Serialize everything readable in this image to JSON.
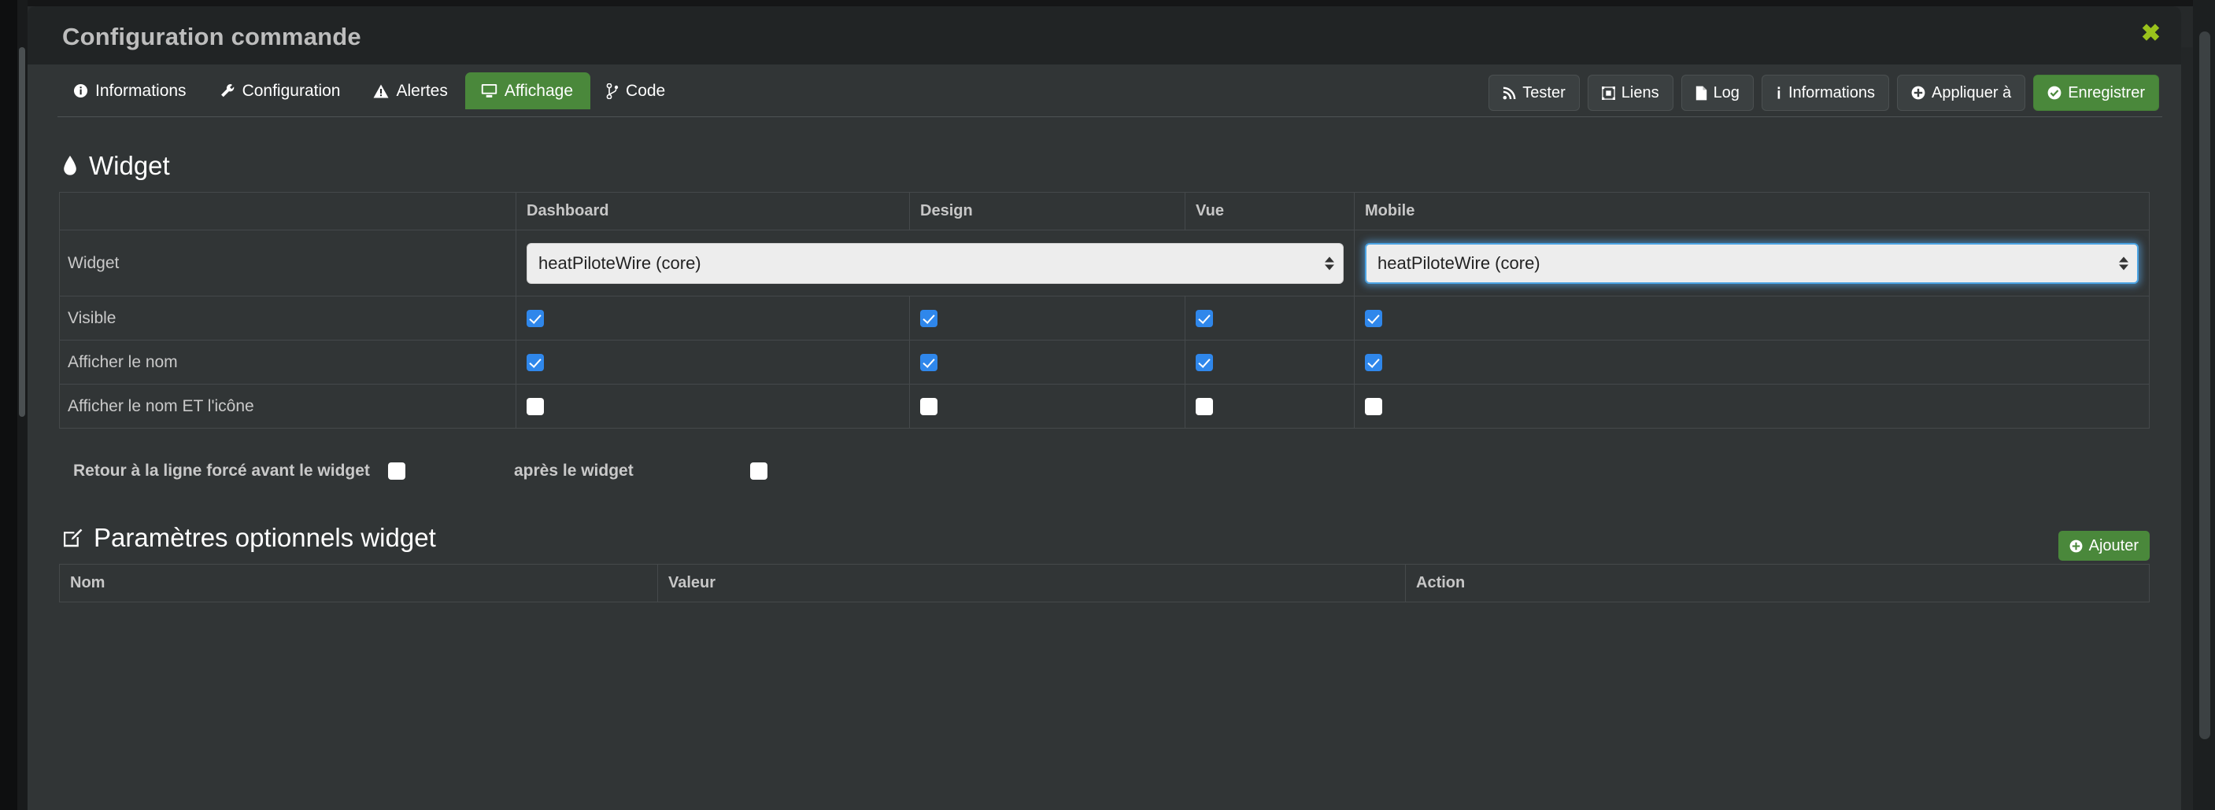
{
  "modal": {
    "title": "Configuration commande",
    "close_label": "✖"
  },
  "tabs": [
    {
      "label": "Informations",
      "icon": "info-circle-icon",
      "active": false
    },
    {
      "label": "Configuration",
      "icon": "wrench-icon",
      "active": false
    },
    {
      "label": "Alertes",
      "icon": "warning-triangle-icon",
      "active": false
    },
    {
      "label": "Affichage",
      "icon": "desktop-icon",
      "active": true
    },
    {
      "label": "Code",
      "icon": "code-branch-icon",
      "active": false
    }
  ],
  "actions": [
    {
      "label": "Tester",
      "icon": "rss-icon",
      "style": "default"
    },
    {
      "label": "Liens",
      "icon": "sitemap-icon",
      "style": "default"
    },
    {
      "label": "Log",
      "icon": "file-icon",
      "style": "default"
    },
    {
      "label": "Informations",
      "icon": "info-icon",
      "style": "default"
    },
    {
      "label": "Appliquer à",
      "icon": "plus-circle-icon",
      "style": "default"
    },
    {
      "label": "Enregistrer",
      "icon": "check-circle-icon",
      "style": "green"
    }
  ],
  "widget_section": {
    "title": "Widget",
    "icon": "tint-droplet-icon",
    "columns": [
      "",
      "Dashboard",
      "Design",
      "Vue",
      "Mobile"
    ],
    "select_row": {
      "label": "Widget",
      "dashboard_value": "heatPiloteWire (core)",
      "mobile_value": "heatPiloteWire (core)"
    },
    "rows": [
      {
        "label": "Visible",
        "dashboard": true,
        "design": true,
        "vue": true,
        "mobile": true
      },
      {
        "label": "Afficher le nom",
        "dashboard": true,
        "design": true,
        "vue": true,
        "mobile": true
      },
      {
        "label": "Afficher le nom ET l'icône",
        "dashboard": false,
        "design": false,
        "vue": false,
        "mobile": false
      }
    ]
  },
  "linebreak": {
    "before_label": "Retour à la ligne forcé avant le widget",
    "before_checked": false,
    "after_label": "après le widget",
    "after_checked": false
  },
  "optional_section": {
    "title": "Paramètres optionnels widget",
    "icon": "edit-pencil-icon",
    "add_label": "Ajouter",
    "add_icon": "plus-circle-icon",
    "columns": [
      "Nom",
      "Valeur",
      "Action"
    ],
    "rows": []
  },
  "colors": {
    "accent_green": "#4a883b",
    "checkbox_blue": "#2f87eb",
    "close_green": "#9ac21c",
    "modal_bg": "#313536",
    "header_bg": "#212425"
  }
}
